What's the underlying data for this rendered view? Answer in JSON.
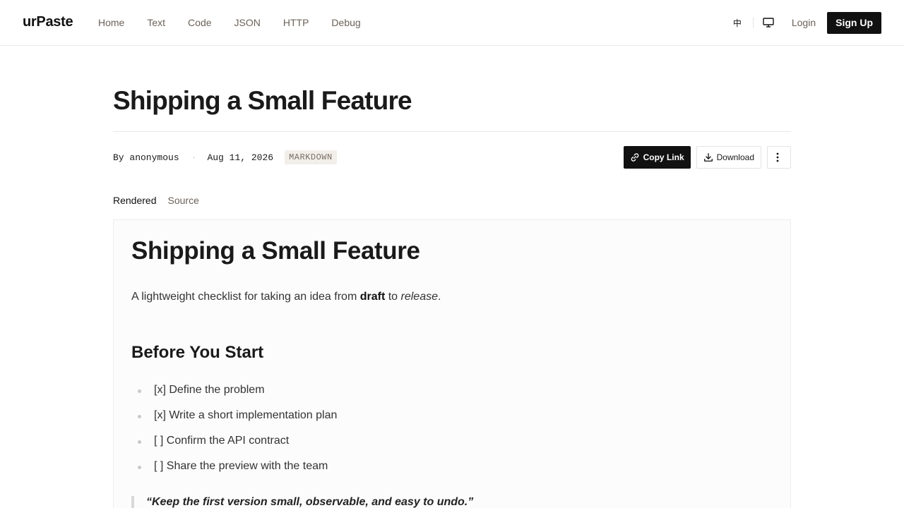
{
  "app": {
    "logo": "urPaste"
  },
  "nav": {
    "items": [
      "Home",
      "Text",
      "Code",
      "JSON",
      "HTTP",
      "Debug"
    ]
  },
  "tools": {
    "lang": "中",
    "login": "Login",
    "signup": "Sign Up",
    "monitor_icon": "monitor-icon"
  },
  "paste": {
    "title": "Shipping a Small Feature",
    "by": "By anonymous",
    "date": "Aug 11, 2026",
    "format": "MARKDOWN",
    "separator": "·"
  },
  "actions": {
    "copy": "Copy Link",
    "download": "Download",
    "more_icon": "more-vertical-icon"
  },
  "tabs": {
    "rendered": "Rendered",
    "source": "Source"
  },
  "doc": {
    "h1": "Shipping a Small Feature",
    "intro_pre": "A lightweight checklist for taking an idea from ",
    "intro_bold": "draft",
    "intro_mid": " to ",
    "intro_italic": "release",
    "intro_post": ".",
    "h2": "Before You Start",
    "checklist": [
      "[x] Define the problem",
      "[x] Write a short implementation plan",
      "[ ] Confirm the API contract",
      "[ ] Share the preview with the team"
    ],
    "quote": "“Keep the first version small, observable, and easy to undo.”"
  },
  "colors": {
    "primary": "#111111",
    "muted": "#6b6259",
    "badge_bg": "#f2efea",
    "border": "#e8e8e8"
  }
}
